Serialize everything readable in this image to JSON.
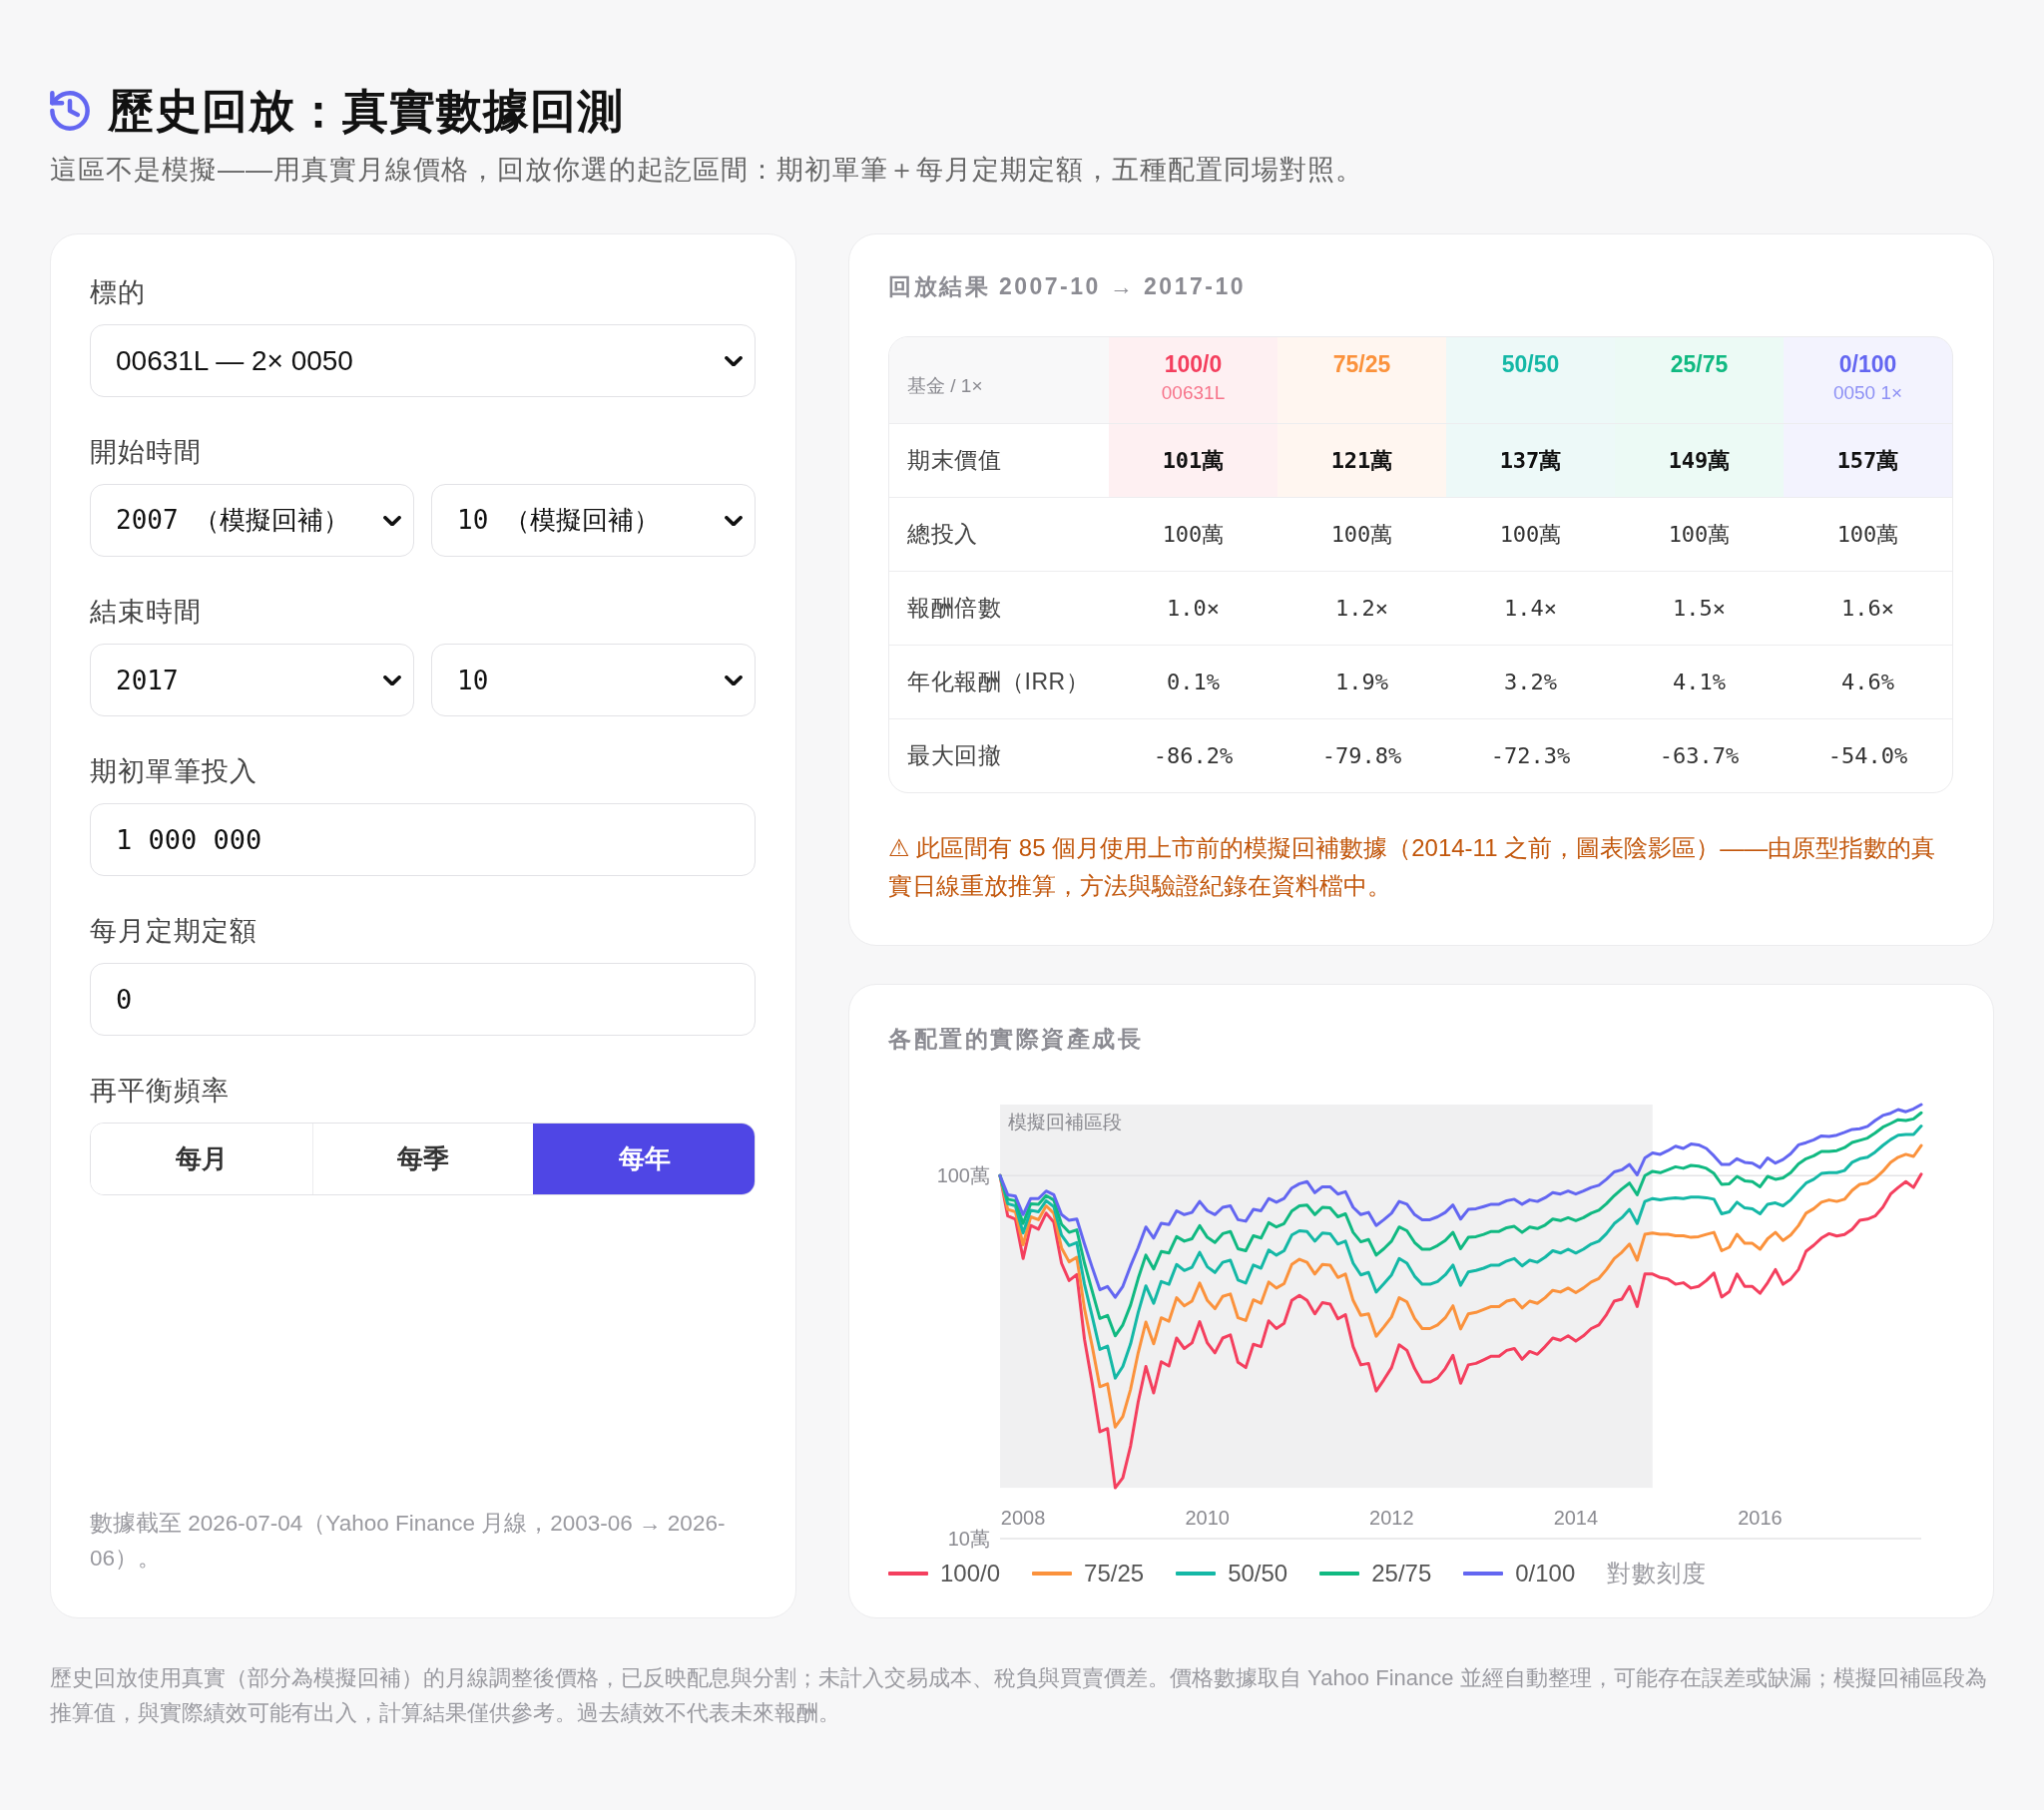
{
  "header": {
    "title": "歷史回放：真實數據回測",
    "subtitle": "這區不是模擬——用真實月線價格，回放你選的起訖區間：期初單筆＋每月定期定額，五種配置同場對照。"
  },
  "settings_panel": {
    "fields": [
      {
        "label": "標的",
        "controls": [
          {
            "kind": "select",
            "value": "00631L — 2× 0050"
          }
        ]
      },
      {
        "label": "開始時間",
        "controls": [
          {
            "kind": "numeric",
            "value": "2007 （模擬回補）"
          },
          {
            "kind": "numeric",
            "value": "10 （模擬回補）"
          }
        ]
      },
      {
        "label": "結束時間",
        "controls": [
          {
            "kind": "numeric",
            "value": "2017"
          },
          {
            "kind": "numeric",
            "value": "10"
          }
        ]
      },
      {
        "label": "期初單筆投入",
        "controls": [
          {
            "kind": "input",
            "value": "1 000 000"
          }
        ]
      },
      {
        "label": "每月定期定額",
        "controls": [
          {
            "kind": "input",
            "value": "0"
          }
        ]
      },
      {
        "label": "再平衡頻率",
        "controls": [
          {
            "kind": "segmented",
            "options": [
              {
                "label": "每月",
                "selected": false
              },
              {
                "label": "每季",
                "selected": false
              },
              {
                "label": "每年",
                "selected": true
              }
            ]
          }
        ]
      }
    ],
    "footnote": "數據截至 2026-07-04（Yahoo Finance 月線，2003-06 → 2026-06）。"
  },
  "results_panel": {
    "title": "回放結果 2007-10 → 2017-10",
    "corner_label": "基金 / 1×",
    "columns": [
      {
        "label": "100/0",
        "sublabel": "00631L",
        "color": "#f43f5e"
      },
      {
        "label": "75/25",
        "color": "#fb923c"
      },
      {
        "label": "50/50",
        "color": "#14b8a6"
      },
      {
        "label": "25/75",
        "color": "#10b981"
      },
      {
        "label": "0/100",
        "sublabel": "0050 1×",
        "color": "#6366f1"
      }
    ],
    "rows": [
      {
        "label": "期末價值",
        "highlight": true,
        "values": [
          "101萬",
          "121萬",
          "137萬",
          "149萬",
          "157萬"
        ]
      },
      {
        "label": "總投入",
        "highlight": false,
        "values": [
          "100萬",
          "100萬",
          "100萬",
          "100萬",
          "100萬"
        ]
      },
      {
        "label": "報酬倍數",
        "highlight": false,
        "values": [
          "1.0×",
          "1.2×",
          "1.4×",
          "1.5×",
          "1.6×"
        ]
      },
      {
        "label": "年化報酬（IRR）",
        "highlight": false,
        "values": [
          "0.1%",
          "1.9%",
          "3.2%",
          "4.1%",
          "4.6%"
        ]
      },
      {
        "label": "最大回撤",
        "highlight": false,
        "values": [
          "-86.2%",
          "-79.8%",
          "-72.3%",
          "-63.7%",
          "-54.0%"
        ]
      }
    ],
    "note": "⚠ 此區間有 85 個月使用上市前的模擬回補數據（2014-11 之前，圖表陰影區）——由原型指數的真實日線重放推算，方法與驗證紀錄在資料檔中。"
  },
  "growth_panel": {
    "title": "各配置的實際資產成長",
    "scale_note": "對數刻度",
    "chart_data": {
      "type": "line",
      "x": [
        2007.75,
        2007.833,
        2007.917,
        2008,
        2008.083,
        2008.167,
        2008.25,
        2008.333,
        2008.417,
        2008.5,
        2008.583,
        2008.667,
        2008.75,
        2008.833,
        2008.917,
        2009,
        2009.083,
        2009.167,
        2009.25,
        2009.333,
        2009.417,
        2009.5,
        2009.583,
        2009.667,
        2009.75,
        2009.833,
        2009.917,
        2010,
        2010.083,
        2010.167,
        2010.25,
        2010.333,
        2010.417,
        2010.5,
        2010.583,
        2010.667,
        2010.75,
        2010.833,
        2010.917,
        2011,
        2011.083,
        2011.167,
        2011.25,
        2011.333,
        2011.417,
        2011.5,
        2011.583,
        2011.667,
        2011.75,
        2011.833,
        2011.917,
        2012,
        2012.083,
        2012.167,
        2012.25,
        2012.333,
        2012.417,
        2012.5,
        2012.583,
        2012.667,
        2012.75,
        2012.833,
        2012.917,
        2013,
        2013.083,
        2013.167,
        2013.25,
        2013.333,
        2013.417,
        2013.5,
        2013.583,
        2013.667,
        2013.75,
        2013.833,
        2013.917,
        2014,
        2014.083,
        2014.167,
        2014.25,
        2014.333,
        2014.417,
        2014.5,
        2014.583,
        2014.667,
        2014.75,
        2014.833,
        2014.917,
        2015,
        2015.083,
        2015.167,
        2015.25,
        2015.333,
        2015.417,
        2015.5,
        2015.583,
        2015.667,
        2015.75,
        2015.833,
        2015.917,
        2016,
        2016.083,
        2016.167,
        2016.25,
        2016.333,
        2016.417,
        2016.5,
        2016.583,
        2016.667,
        2016.75,
        2016.833,
        2016.917,
        2017,
        2017.083,
        2017.167,
        2017.25,
        2017.333,
        2017.417,
        2017.5,
        2017.583,
        2017.667,
        2017.75
      ],
      "series": [
        {
          "name": "100/0",
          "color": "#f43f5e",
          "values": [
            100,
            77.4,
            75.9,
            59.1,
            72.9,
            71.2,
            78.8,
            74.5,
            57.4,
            51.4,
            53.4,
            35.4,
            26.8,
            19.7,
            20.1,
            13.8,
            14.7,
            18.0,
            23.8,
            29.8,
            25.2,
            30.7,
            29.9,
            35.7,
            33.4,
            34.6,
            39.6,
            34.6,
            32.5,
            35.7,
            36.4,
            30.6,
            29.6,
            34.3,
            33.8,
            39.8,
            37.9,
            39.2,
            45.3,
            46.8,
            45.3,
            41.6,
            44.7,
            44.3,
            40.3,
            41.4,
            33.8,
            30.1,
            30.4,
            25.5,
            27.4,
            29.6,
            34.2,
            33.0,
            29.4,
            27.0,
            27.0,
            27.7,
            29.4,
            32.0,
            26.8,
            30.1,
            30.4,
            31.1,
            31.8,
            31.8,
            33.0,
            33.4,
            31.2,
            32.8,
            32.2,
            33.8,
            35.7,
            35.2,
            36.2,
            35.0,
            36.2,
            37.9,
            38.8,
            41.4,
            45.1,
            45.7,
            49.5,
            43.6,
            53.6,
            53.6,
            52.4,
            51.9,
            50.2,
            50.7,
            49.0,
            49.5,
            51.4,
            53.9,
            46.3,
            47.9,
            53.6,
            49.5,
            49.5,
            47.4,
            50.7,
            55.1,
            50.2,
            51.9,
            55.1,
            61.9,
            64.3,
            67.3,
            69.2,
            68.2,
            68.8,
            71.2,
            75.3,
            75.9,
            77.4,
            81.8,
            89.0,
            92.8,
            96.3,
            92.8,
            101
          ]
        },
        {
          "name": "75/25",
          "color": "#fb923c",
          "values": [
            100,
            80.7,
            79.5,
            64.5,
            77.0,
            75.6,
            82.6,
            78.8,
            63.2,
            57.9,
            59.6,
            43.0,
            33.9,
            26.2,
            26.7,
            20.3,
            21.7,
            25.8,
            32.5,
            39.5,
            34.4,
            40.6,
            39.7,
            46.1,
            43.8,
            45.1,
            50.6,
            45.3,
            43.0,
            46.5,
            47.2,
            40.6,
            39.9,
            45.5,
            44.5,
            50.9,
            49.0,
            50.4,
            56.9,
            58.8,
            57.7,
            53.6,
            56.9,
            56.7,
            52.4,
            53.6,
            45.3,
            41.2,
            41.6,
            36.1,
            38.3,
            40.8,
            46.1,
            44.9,
            40.4,
            37.9,
            37.9,
            38.8,
            40.6,
            43.8,
            37.8,
            41.6,
            42.0,
            42.8,
            43.6,
            43.6,
            45.1,
            45.6,
            43.2,
            45.1,
            44.5,
            46.1,
            48.3,
            47.8,
            49.0,
            47.6,
            49.0,
            50.9,
            52.1,
            55.1,
            59.1,
            61.5,
            64.8,
            58.5,
            68.9,
            69.5,
            68.9,
            68.9,
            68.3,
            68.3,
            67.6,
            67.9,
            68.9,
            69.8,
            62.1,
            63.5,
            68.9,
            65.1,
            65.1,
            62.7,
            67.0,
            69.8,
            66.3,
            68.6,
            72.8,
            78.8,
            81.1,
            84.5,
            85.7,
            84.9,
            86.1,
            91.1,
            94.6,
            95.4,
            98.2,
            102.8,
            108.8,
            112.4,
            114.5,
            113.0,
            121
          ]
        },
        {
          "name": "50/50",
          "color": "#14b8a6",
          "values": [
            100,
            83.7,
            82.6,
            69.5,
            80.3,
            79.5,
            85.3,
            82.2,
            68.6,
            64.2,
            65.4,
            50.2,
            41.0,
            33.2,
            33.9,
            27.7,
            29.8,
            34.4,
            42.0,
            49.7,
            44.5,
            51.1,
            50.2,
            56.9,
            54.8,
            55.9,
            61.5,
            56.1,
            54.1,
            57.7,
            58.5,
            51.6,
            50.6,
            56.7,
            55.6,
            62.4,
            60.4,
            62.1,
            68.6,
            70.5,
            70.2,
            66.0,
            69.5,
            69.2,
            64.8,
            66.0,
            57.4,
            53.3,
            54.1,
            47.8,
            50.4,
            53.3,
            59.1,
            57.4,
            52.8,
            50.2,
            50.2,
            51.1,
            53.3,
            56.7,
            49.9,
            54.3,
            54.8,
            55.6,
            56.7,
            56.7,
            58.2,
            59.1,
            56.4,
            58.5,
            57.7,
            59.6,
            62.1,
            61.2,
            62.7,
            61.2,
            62.7,
            64.8,
            66.0,
            69.2,
            73.8,
            76.6,
            80.7,
            73.8,
            84.9,
            86.5,
            85.7,
            86.5,
            86.9,
            86.5,
            87.3,
            87.3,
            86.9,
            86.1,
            78.5,
            79.5,
            84.5,
            81.5,
            81.1,
            78.5,
            83.4,
            84.1,
            82.6,
            85.7,
            90.7,
            95.4,
            97.7,
            101.4,
            101.9,
            101.9,
            103.3,
            108.8,
            111.3,
            112.4,
            116.1,
            121.1,
            125.7,
            129.3,
            129.9,
            129.9,
            137
          ]
        },
        {
          "name": "25/75",
          "color": "#10b981",
          "values": [
            100,
            86.1,
            85.3,
            73.8,
            83.7,
            83.4,
            88.1,
            85.7,
            73.5,
            69.8,
            70.9,
            57.4,
            48.1,
            40.4,
            41.2,
            36.2,
            38.8,
            44.0,
            52.1,
            60.4,
            55.3,
            61.8,
            61.2,
            67.9,
            66.0,
            67.0,
            72.8,
            67.6,
            65.4,
            69.2,
            70.2,
            62.9,
            62.1,
            68.3,
            67.3,
            74.2,
            72.2,
            73.8,
            79.9,
            82.6,
            83.0,
            78.1,
            81.8,
            81.5,
            77.0,
            78.5,
            69.8,
            65.7,
            66.7,
            60.4,
            62.9,
            66.0,
            72.2,
            70.5,
            65.4,
            62.7,
            62.7,
            64.2,
            66.3,
            69.8,
            62.9,
            67.6,
            67.9,
            68.9,
            70.2,
            70.2,
            71.9,
            72.5,
            69.8,
            72.2,
            71.5,
            73.1,
            75.9,
            75.2,
            76.6,
            75.2,
            76.6,
            78.8,
            80.3,
            83.7,
            88.1,
            91.9,
            95.4,
            88.6,
            100,
            102.8,
            101.9,
            103.8,
            105.8,
            104.8,
            106.7,
            106.2,
            104.8,
            101.4,
            94.6,
            95.0,
            99.5,
            96.8,
            96.3,
            93.2,
            99.5,
            97.7,
            98.6,
            101.9,
            107.7,
            111.3,
            113.4,
            116.6,
            116.6,
            117.2,
            119.4,
            123.4,
            125.1,
            126.9,
            131.1,
            136.0,
            139.2,
            142.6,
            141.9,
            143.3,
            149
          ]
        },
        {
          "name": "0/100",
          "color": "#6366f1",
          "values": [
            100,
            88.6,
            87.8,
            78.1,
            86.5,
            86.5,
            90.7,
            88.6,
            78.1,
            75.3,
            75.9,
            64.8,
            55.9,
            48.5,
            49.5,
            46.2,
            49.5,
            56.4,
            63.3,
            72.2,
            67.3,
            73.9,
            73.3,
            80.0,
            78.1,
            79.2,
            84.9,
            80.0,
            78.1,
            81.8,
            82.6,
            75.6,
            74.9,
            80.7,
            80.0,
            86.5,
            84.5,
            86.5,
            92.4,
            95.0,
            96.3,
            89.8,
            93.2,
            93.2,
            89.0,
            90.3,
            81.8,
            78.1,
            79.2,
            72.9,
            75.6,
            78.8,
            84.9,
            83.4,
            78.1,
            75.6,
            75.6,
            77.0,
            79.2,
            83.0,
            75.9,
            80.7,
            81.1,
            82.2,
            83.4,
            83.4,
            85.3,
            86.1,
            83.4,
            85.7,
            84.9,
            86.9,
            89.8,
            89.0,
            90.7,
            89.0,
            90.7,
            92.8,
            94.1,
            97.7,
            102.4,
            103.8,
            107.3,
            100.5,
            111.9,
            115.5,
            114.5,
            117.2,
            120.5,
            118.8,
            122.2,
            121.6,
            118.8,
            113.4,
            107.3,
            107.3,
            111.3,
            108.8,
            108.3,
            105.3,
            111.9,
            108.3,
            110.8,
            115.0,
            121.6,
            123.3,
            125.6,
            128.7,
            128.1,
            129.3,
            131.6,
            134.1,
            134.7,
            136.7,
            141.9,
            146.5,
            148.6,
            152.1,
            150.0,
            152.8,
            157
          ]
        }
      ],
      "xlim": [
        2007.75,
        2017.75
      ],
      "ylim": [
        10,
        157
      ],
      "log": true,
      "xticks": [
        2008,
        2010,
        2012,
        2014,
        2016
      ],
      "yticks": [
        {
          "value": 10,
          "label": "10萬"
        },
        {
          "value": 100,
          "label": "100萬"
        }
      ],
      "bands": [
        {
          "axis": "x",
          "from": 2007.75,
          "to": 2014.833,
          "label": "模擬回補區段"
        }
      ]
    }
  },
  "disclaimer": "歷史回放使用真實（部分為模擬回補）的月線調整後價格，已反映配息與分割；未計入交易成本、稅負與買賣價差。價格數據取自 Yahoo Finance 並經自動整理，可能存在誤差或缺漏；模擬回補區段為推算值，與實際績效可能有出入，計算結果僅供參考。過去績效不代表未來報酬。"
}
